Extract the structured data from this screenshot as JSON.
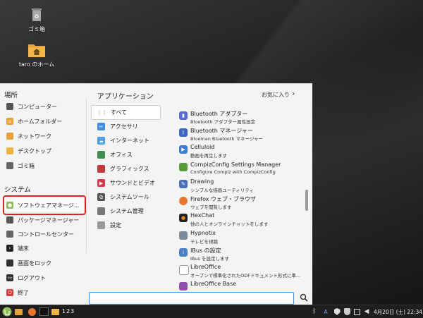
{
  "desktop": {
    "icons": [
      {
        "label": "ゴミ箱",
        "icon": "trash-icon"
      },
      {
        "label": "taro のホーム",
        "icon": "home-folder-icon"
      }
    ]
  },
  "menu": {
    "places_title": "場所",
    "places": [
      {
        "label": "コンピューター",
        "icon": "computer-icon"
      },
      {
        "label": "ホームフォルダー",
        "icon": "home-folder-icon"
      },
      {
        "label": "ネットワーク",
        "icon": "network-icon"
      },
      {
        "label": "デスクトップ",
        "icon": "desktop-folder-icon"
      },
      {
        "label": "ゴミ箱",
        "icon": "trash-icon"
      }
    ],
    "system_title": "システム",
    "system": [
      {
        "label": "ソフトウェアマネージ...",
        "icon": "software-manager-icon",
        "selected": true
      },
      {
        "label": "パッケージマネージャー",
        "icon": "package-manager-icon"
      },
      {
        "label": "コントロールセンター",
        "icon": "control-center-icon"
      },
      {
        "label": "端末",
        "icon": "terminal-icon"
      },
      {
        "label": "画面をロック",
        "icon": "lock-icon"
      },
      {
        "label": "ログアウト",
        "icon": "logout-icon"
      },
      {
        "label": "終了",
        "icon": "power-icon"
      }
    ],
    "apps_title": "アプリケーション",
    "favorites_label": "お気に入り",
    "categories": [
      {
        "label": "すべて",
        "icon": "grid-icon",
        "active": true
      },
      {
        "label": "アクセサリ",
        "icon": "accessories-icon"
      },
      {
        "label": "インターネット",
        "icon": "internet-icon"
      },
      {
        "label": "オフィス",
        "icon": "office-icon"
      },
      {
        "label": "グラフィックス",
        "icon": "graphics-icon"
      },
      {
        "label": "サウンドとビデオ",
        "icon": "sound-video-icon"
      },
      {
        "label": "システムツール",
        "icon": "system-tools-icon"
      },
      {
        "label": "システム管理",
        "icon": "administration-icon"
      },
      {
        "label": "設定",
        "icon": "settings-icon"
      }
    ],
    "apps": [
      {
        "name": "Bluetooth アダプター",
        "desc": "Bluetooth アダプター属性設定",
        "icon": "bluetooth-adapter-icon",
        "color": "#5a6bd8"
      },
      {
        "name": "Bluetooth マネージャー",
        "desc": "Blueman Bluetooth マネージャー",
        "icon": "bluetooth-icon",
        "color": "#3b66c4"
      },
      {
        "name": "Celluloid",
        "desc": "動画を再生します",
        "icon": "celluloid-icon",
        "color": "#3d7bd6"
      },
      {
        "name": "CompizConfig Settings Manager",
        "desc": "Configure Compiz with CompizConfig",
        "icon": "compiz-icon",
        "color": "#5a9a3a"
      },
      {
        "name": "Drawing",
        "desc": "シンプルな描画ユーティリティ",
        "icon": "drawing-icon",
        "color": "#4a70b8"
      },
      {
        "name": "Firefox ウェブ・ブラウザ",
        "desc": "ウェブを閲覧します",
        "icon": "firefox-icon",
        "color": "#e8772e"
      },
      {
        "name": "HexChat",
        "desc": "他の人とオンラインチャットをします",
        "icon": "hexchat-icon",
        "color": "#222222"
      },
      {
        "name": "Hypnotix",
        "desc": "テレビを視聴",
        "icon": "hypnotix-icon",
        "color": "#7a8a9a"
      },
      {
        "name": "IBus の設定",
        "desc": "IBus を設定します",
        "icon": "ibus-icon",
        "color": "#4a7fc8"
      },
      {
        "name": "LibreOffice",
        "desc": "オープンで標準化されたODFドキュメント形式に準...",
        "icon": "libreoffice-icon",
        "color": "#ffffff"
      },
      {
        "name": "LibreOffice Base",
        "desc": "",
        "icon": "libreoffice-base-icon",
        "color": "#8e4fb0"
      }
    ],
    "search": {
      "value": "",
      "placeholder": ""
    }
  },
  "panel": {
    "workspaces": [
      "1",
      "2",
      "3"
    ],
    "input_method": "A",
    "clock": "4月20日 (土) 22:34"
  },
  "colors": {
    "accent": "#3b8ee4",
    "selection_border": "#dd2222",
    "mint_green": "#8fbc5a"
  }
}
